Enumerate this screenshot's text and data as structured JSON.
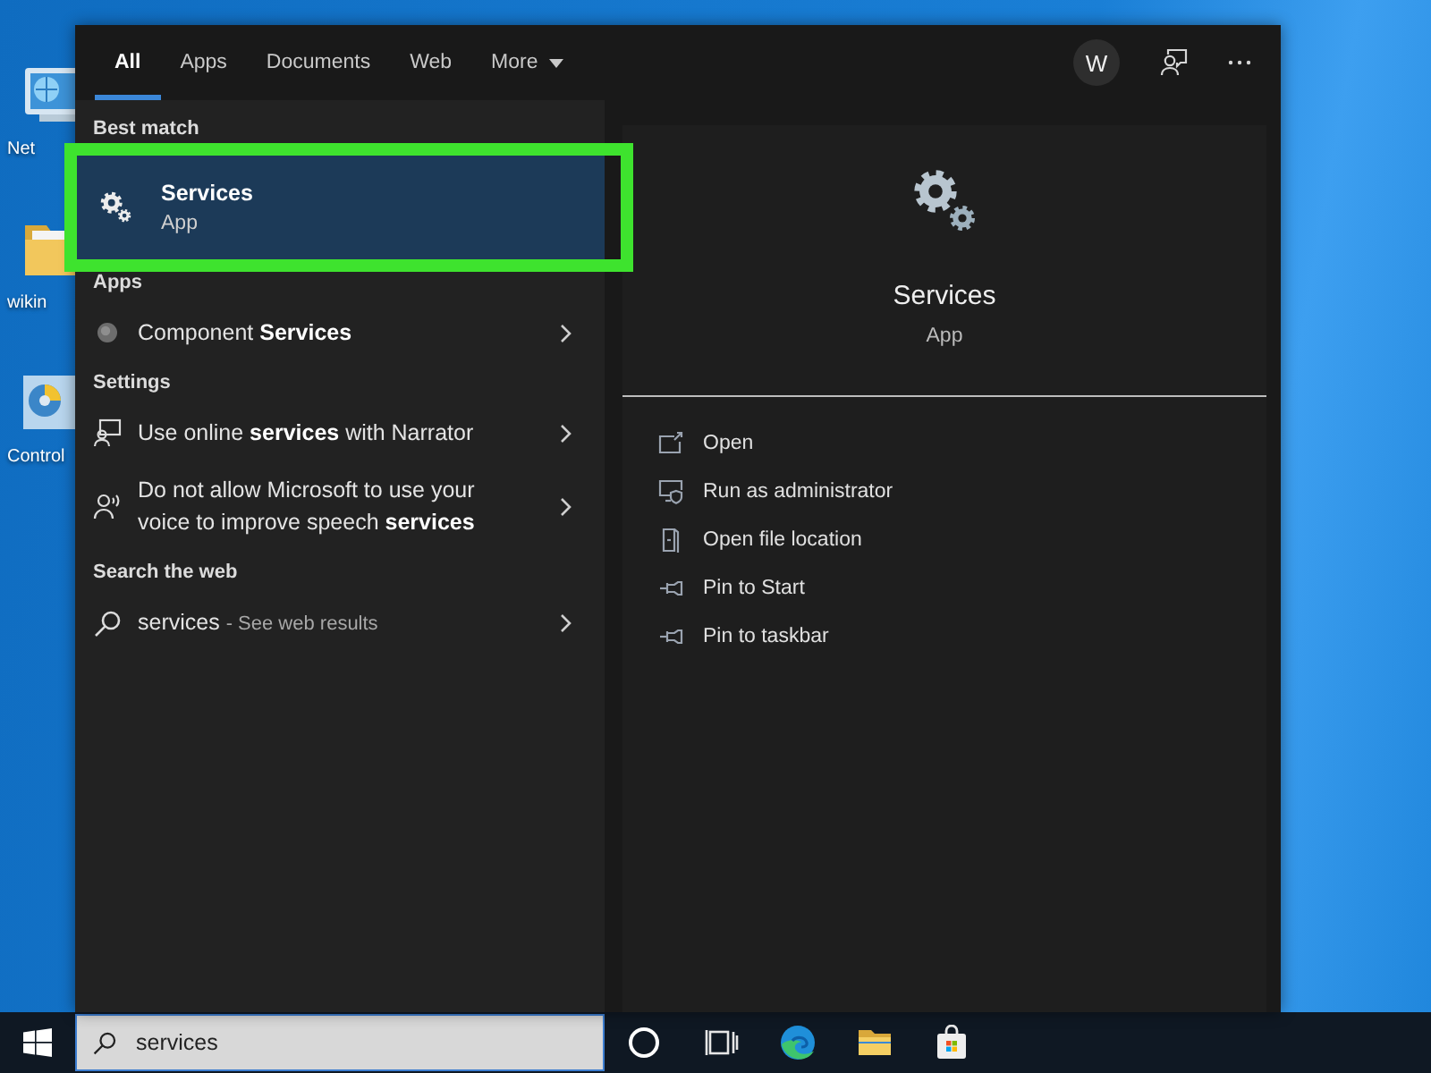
{
  "desktop_icons": [
    {
      "label": "Net"
    },
    {
      "label": "wikin"
    },
    {
      "label": "Control"
    }
  ],
  "search_panel": {
    "tabs": [
      {
        "label": "All",
        "kind": "tab",
        "selected": true
      },
      {
        "label": "Apps",
        "kind": "tab",
        "selected": false
      },
      {
        "label": "Documents",
        "kind": "tab",
        "selected": false
      },
      {
        "label": "Web",
        "kind": "tab",
        "selected": false
      },
      {
        "label": "More",
        "kind": "menu",
        "selected": false
      }
    ],
    "account": "W",
    "sections": [
      {
        "heading": "Best match",
        "items": [
          {
            "kind": "best_match",
            "title": "Services",
            "subtitle": "App",
            "selected": true,
            "outlined": true
          }
        ]
      },
      {
        "heading": "Apps",
        "items": [
          {
            "kind": "result",
            "text": "Component **Services**",
            "selected": false
          }
        ]
      },
      {
        "heading": "Settings",
        "items": [
          {
            "kind": "result",
            "text": "Use online **services** with Narrator",
            "selected": false
          },
          {
            "kind": "result",
            "text": "Do not allow Microsoft to use your voice to improve speech **services**",
            "selected": false
          }
        ]
      },
      {
        "heading": "Search the web",
        "items": [
          {
            "kind": "web",
            "query": "services",
            "hint": "- See web results",
            "selected": false
          }
        ]
      }
    ],
    "preview": {
      "title": "Services",
      "subtitle": "App",
      "actions": [
        {
          "label": "Open"
        },
        {
          "label": "Run as administrator"
        },
        {
          "label": "Open file location"
        },
        {
          "label": "Pin to Start"
        },
        {
          "label": "Pin to taskbar"
        }
      ]
    }
  },
  "taskbar": {
    "search": {
      "value": "services"
    }
  }
}
